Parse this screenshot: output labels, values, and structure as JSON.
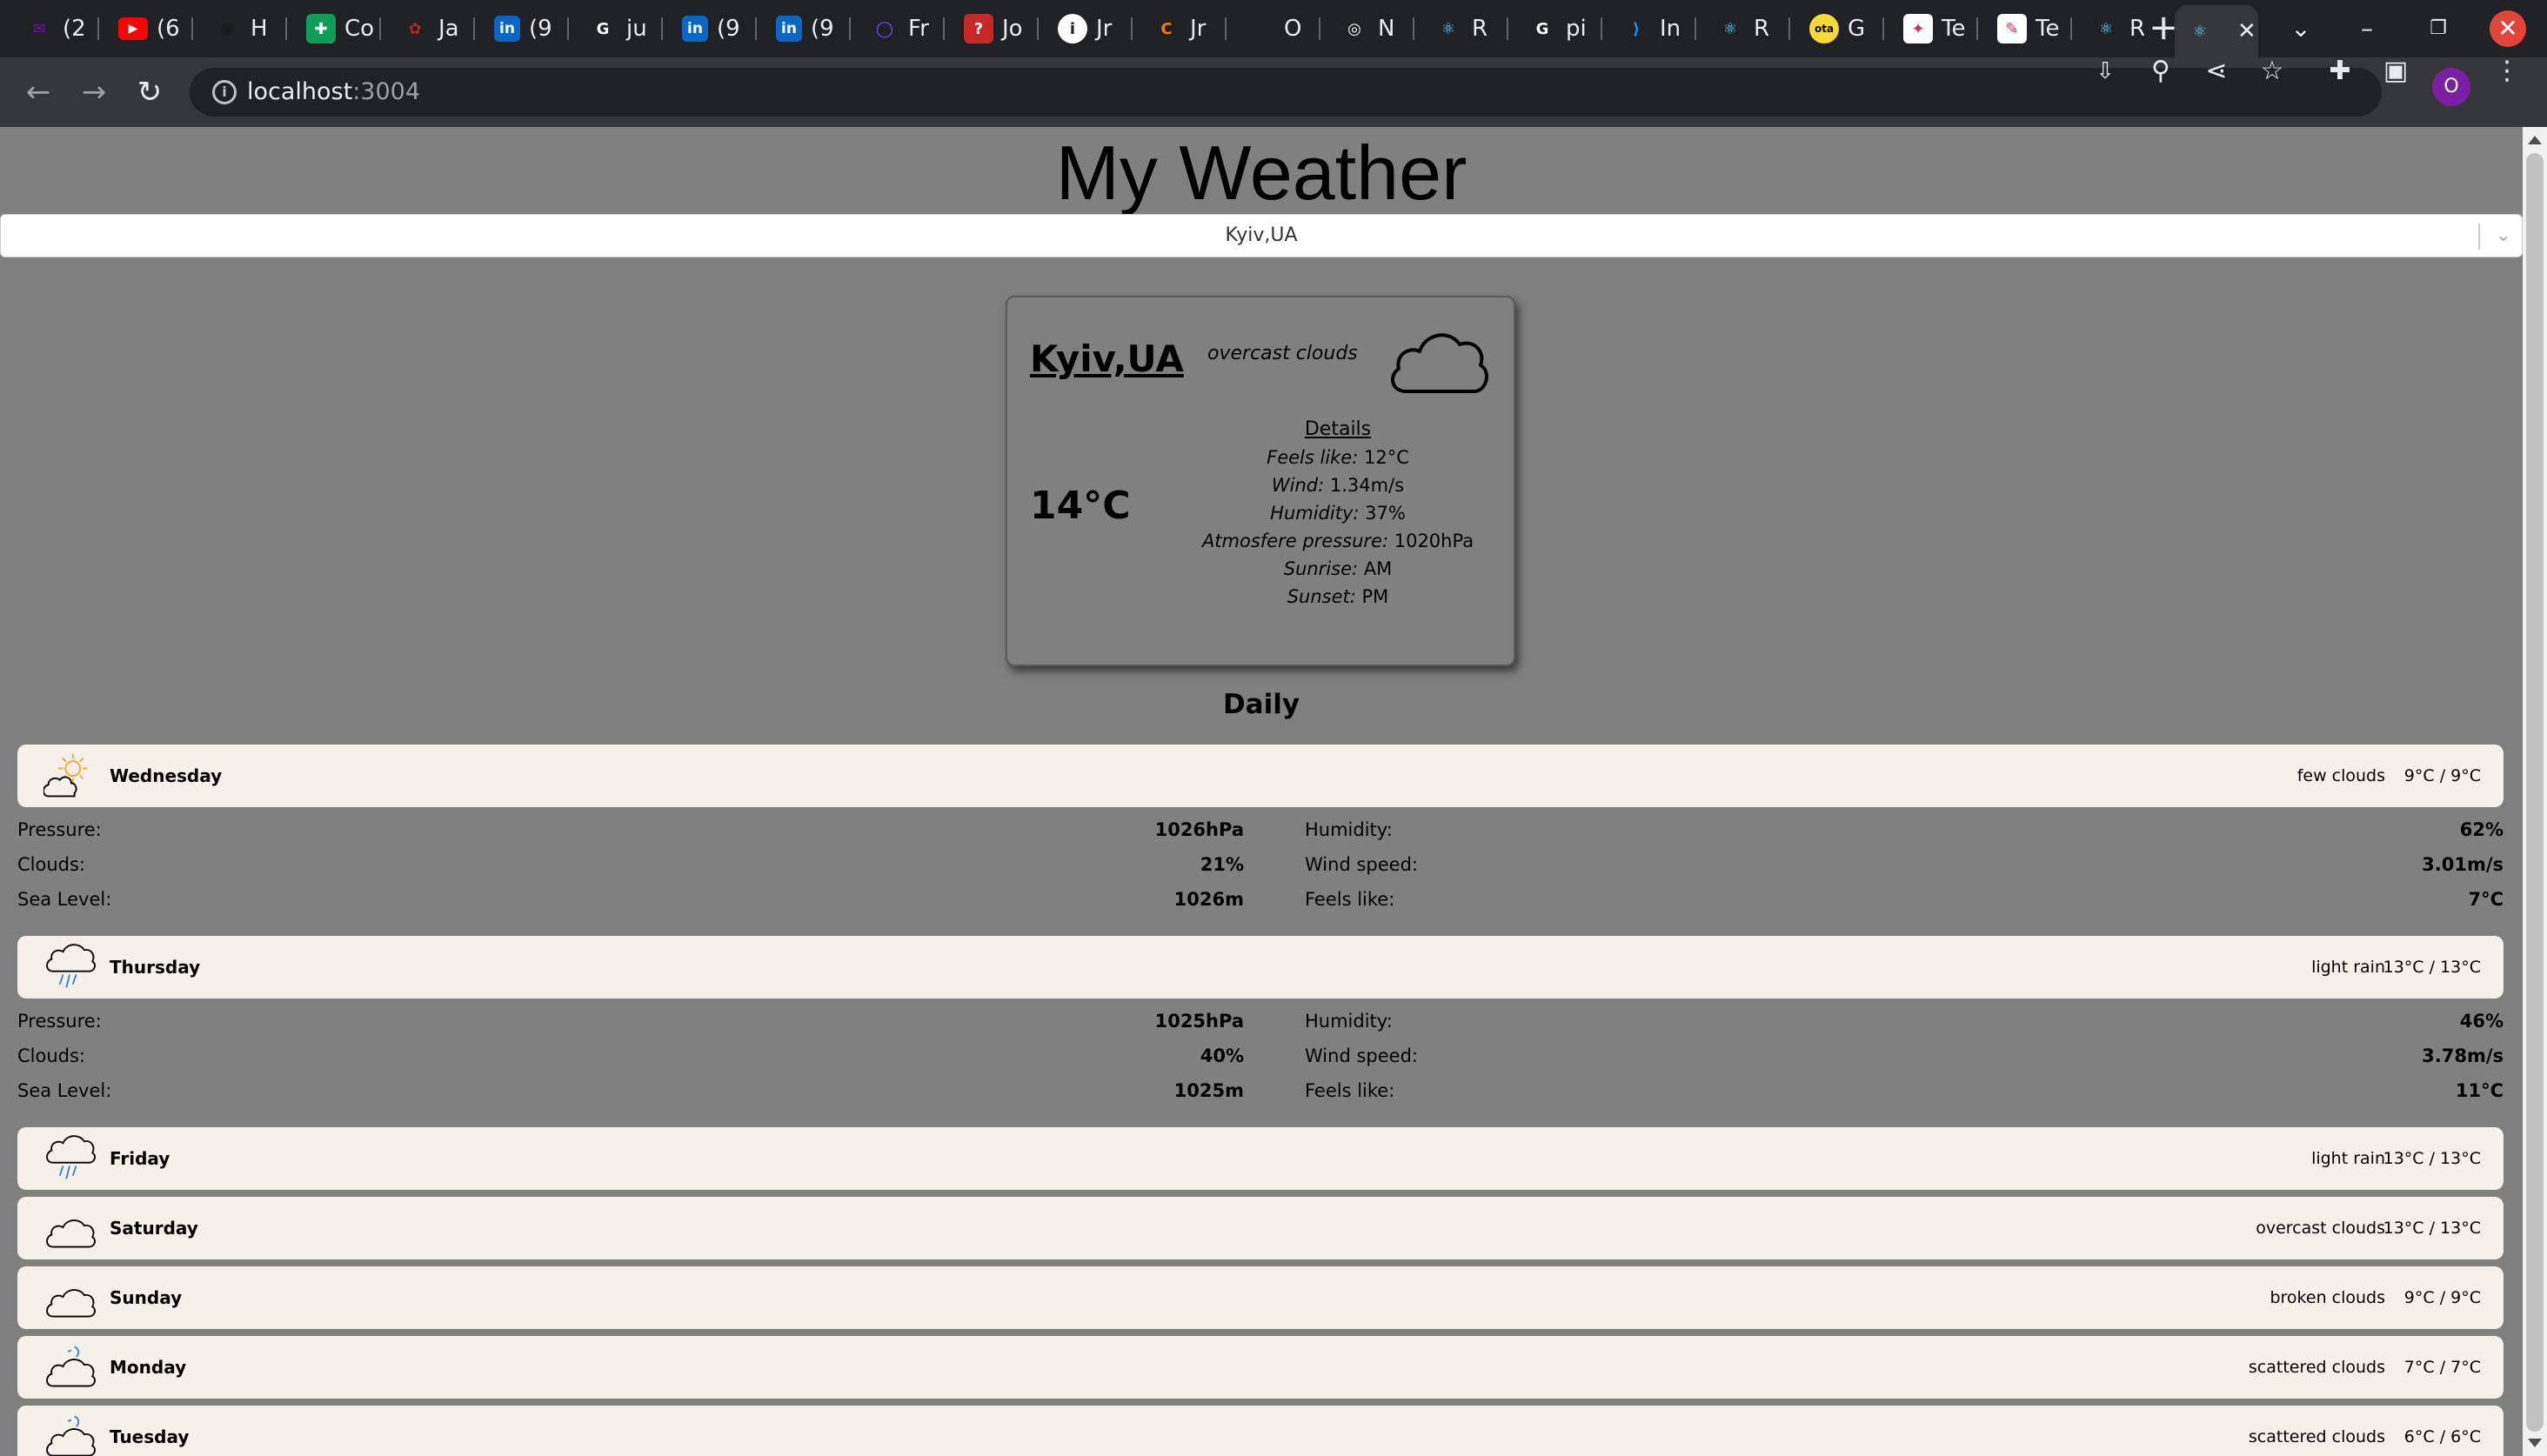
{
  "browser": {
    "tabs": [
      {
        "label": "(2",
        "icon": "mail-icon",
        "color": "#6a1b9a"
      },
      {
        "label": "(6",
        "icon": "youtube-icon",
        "color": "#ff0000"
      },
      {
        "label": "H",
        "icon": "app-icon",
        "color": "#1a1a1a"
      },
      {
        "label": "Co",
        "icon": "sheets-icon",
        "color": "#0f9d58"
      },
      {
        "label": "Ja",
        "icon": "openai-icon",
        "color": "#b3261e"
      },
      {
        "label": "(9",
        "icon": "linkedin-icon",
        "color": "#0a66c2"
      },
      {
        "label": "ju",
        "icon": "google-icon",
        "color": "#ffffff"
      },
      {
        "label": "(9",
        "icon": "linkedin-icon",
        "color": "#0a66c2"
      },
      {
        "label": "(9",
        "icon": "linkedin-icon",
        "color": "#0a66c2"
      },
      {
        "label": "Fr",
        "icon": "circle-icon",
        "color": "#7c4dff"
      },
      {
        "label": "Jo",
        "icon": "question-icon",
        "color": "#c62828"
      },
      {
        "label": "Jr",
        "icon": "info-icon",
        "color": "#ffffff"
      },
      {
        "label": "Jr",
        "icon": "chrome-c-icon",
        "color": "#f57c00"
      },
      {
        "label": "O",
        "icon": "github-icon",
        "color": "#202124"
      },
      {
        "label": "N",
        "icon": "chrome-icon",
        "color": "#ffffff"
      },
      {
        "label": "R",
        "icon": "react-icon",
        "color": "#61dafb"
      },
      {
        "label": "pi",
        "icon": "google-icon",
        "color": "#ffffff"
      },
      {
        "label": "In",
        "icon": "vscode-icon",
        "color": "#2196f3"
      },
      {
        "label": "R",
        "icon": "react-icon",
        "color": "#61dafb"
      },
      {
        "label": "G",
        "icon": "ota-icon",
        "color": "#fdd835"
      },
      {
        "label": "Te",
        "icon": "figma-icon",
        "color": "#ffffff"
      },
      {
        "label": "Te",
        "icon": "pen-icon",
        "color": "#ffffff"
      },
      {
        "label": "R",
        "icon": "react-icon",
        "color": "#61dafb"
      },
      {
        "label": "",
        "icon": "react-icon",
        "color": "#61dafb",
        "active": true
      }
    ],
    "new_tab": "+",
    "url_host": "localhost",
    "url_port": ":3004"
  },
  "app": {
    "title": "My Weather",
    "selected_city": "Kyiv,UA"
  },
  "current": {
    "city": "Kyiv,UA",
    "description": "overcast clouds",
    "icon": "cloud-icon",
    "temp": "14°C",
    "details_heading": "Details",
    "details": [
      {
        "label": "Feels like:",
        "value": "12°C"
      },
      {
        "label": "Wind:",
        "value": "1.34m/s"
      },
      {
        "label": "Humidity:",
        "value": "37%"
      },
      {
        "label": "Atmosfere pressure:",
        "value": "1020hPa"
      },
      {
        "label": "Sunrise:",
        "value": "AM"
      },
      {
        "label": "Sunset:",
        "value": "PM"
      }
    ]
  },
  "daily": {
    "heading": "Daily",
    "days": [
      {
        "name": "Wednesday",
        "icon": "sun-cloud-icon",
        "desc": "few clouds",
        "temp": "9°C / 9°C",
        "expanded": true,
        "details": {
          "pressure_label": "Pressure:",
          "pressure": "1026hPa",
          "clouds_label": "Clouds:",
          "clouds": "21%",
          "sea_label": "Sea Level:",
          "sea": "1026m",
          "humidity_label": "Humidity:",
          "humidity": "62%",
          "wind_label": "Wind speed:",
          "wind": "3.01m/s",
          "feels_label": "Feels like:",
          "feels": "7°C"
        }
      },
      {
        "name": "Thursday",
        "icon": "rain-icon",
        "desc": "light rain",
        "temp": "13°C / 13°C",
        "expanded": true,
        "details": {
          "pressure_label": "Pressure:",
          "pressure": "1025hPa",
          "clouds_label": "Clouds:",
          "clouds": "40%",
          "sea_label": "Sea Level:",
          "sea": "1025m",
          "humidity_label": "Humidity:",
          "humidity": "46%",
          "wind_label": "Wind speed:",
          "wind": "3.78m/s",
          "feels_label": "Feels like:",
          "feels": "11°C"
        }
      },
      {
        "name": "Friday",
        "icon": "rain-icon",
        "desc": "light rain",
        "temp": "13°C / 13°C"
      },
      {
        "name": "Saturday",
        "icon": "cloud-icon",
        "desc": "overcast clouds",
        "temp": "13°C / 13°C"
      },
      {
        "name": "Sunday",
        "icon": "cloud-icon",
        "desc": "broken clouds",
        "temp": "9°C / 9°C"
      },
      {
        "name": "Monday",
        "icon": "wind-cloud-icon",
        "desc": "scattered clouds",
        "temp": "7°C / 7°C"
      },
      {
        "name": "Tuesday",
        "icon": "wind-cloud-icon",
        "desc": "scattered clouds",
        "temp": "6°C / 6°C"
      }
    ]
  }
}
